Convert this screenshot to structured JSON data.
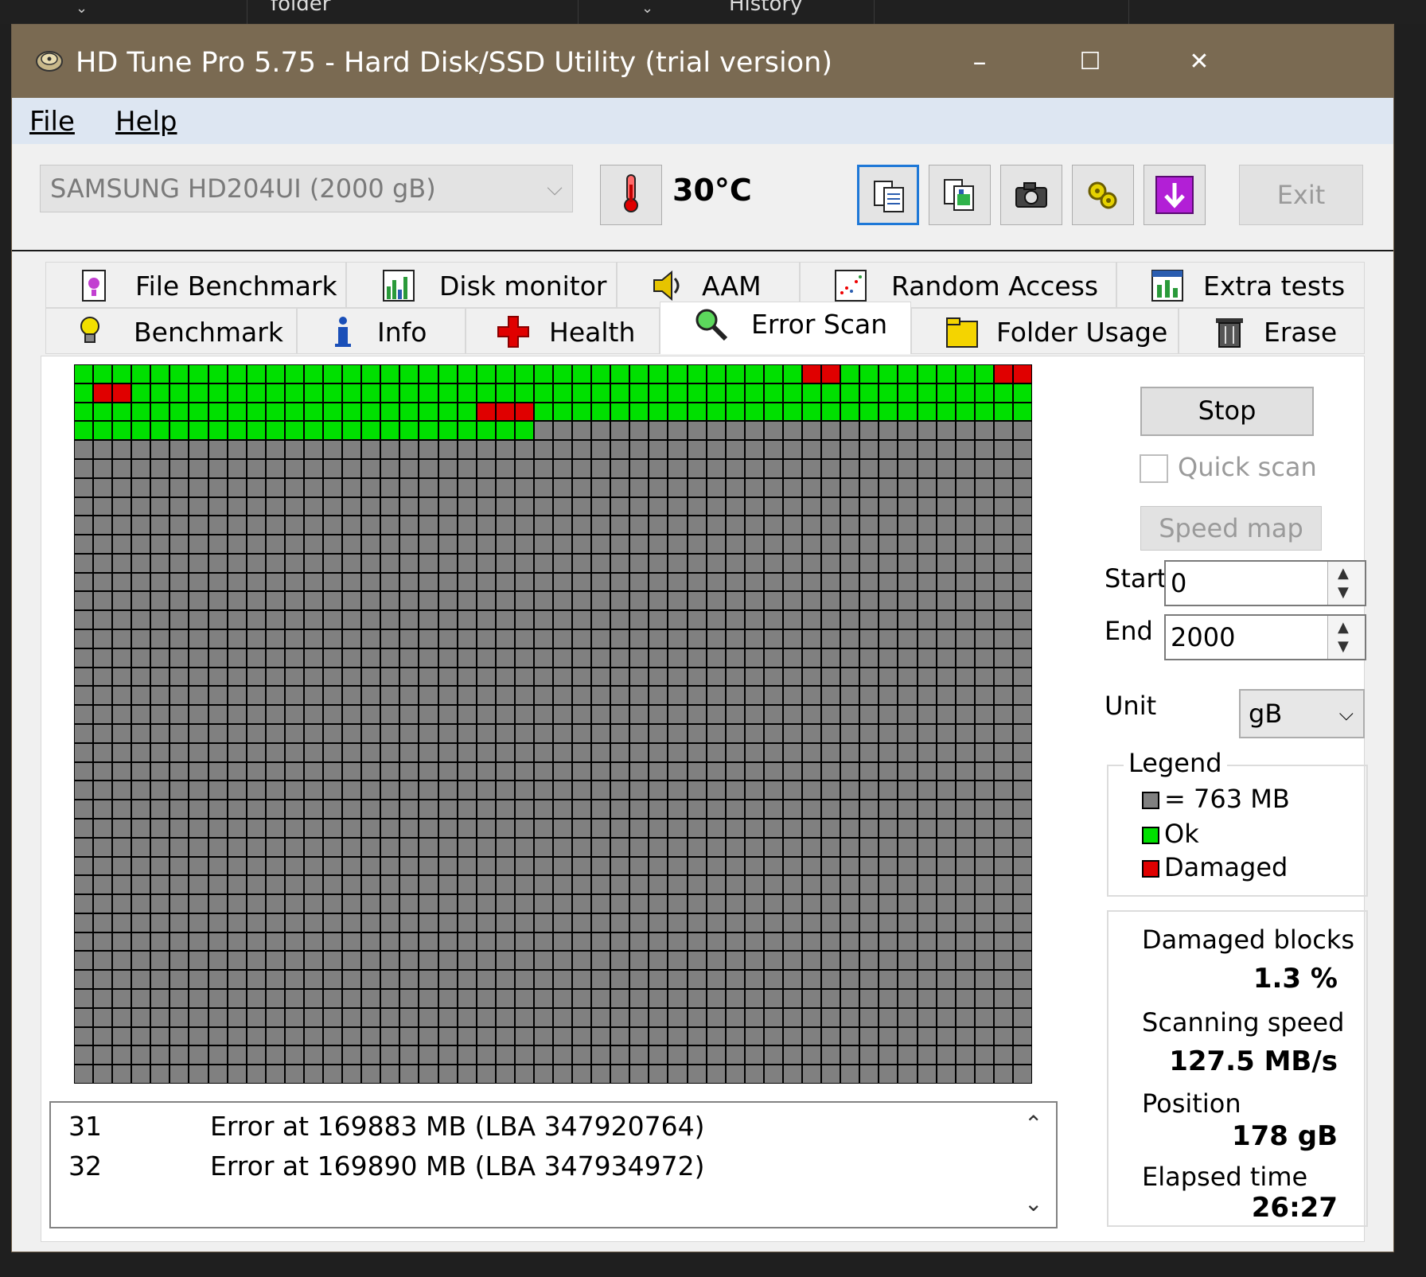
{
  "background": {
    "tabs": [
      {
        "label": "folder"
      },
      {
        "label": "History"
      }
    ]
  },
  "window": {
    "title": "HD Tune Pro 5.75 - Hard Disk/SSD Utility (trial version)",
    "controls": {
      "minimize": "–",
      "maximize": "☐",
      "close": "✕"
    }
  },
  "menu": {
    "file": "File",
    "help": "Help"
  },
  "toolbar": {
    "drive": "SAMSUNG HD204UI (2000 gB)",
    "temperature": "30°C",
    "exit": "Exit",
    "icons": [
      "copy-text-icon",
      "copy-screenshot-icon",
      "camera-icon",
      "options-icon",
      "save-download-icon"
    ]
  },
  "tabs": {
    "row1": [
      "File Benchmark",
      "Disk monitor",
      "AAM",
      "Random Access",
      "Extra tests"
    ],
    "row2": [
      "Benchmark",
      "Info",
      "Health",
      "Error Scan",
      "Folder Usage",
      "Erase"
    ],
    "active": "Error Scan"
  },
  "scan": {
    "grid_cols": 50,
    "grid_rows": 38,
    "scanned_rows_full": 3,
    "scanned_cells_row4": 24,
    "damaged_cells": [
      [
        0,
        38
      ],
      [
        0,
        39
      ],
      [
        0,
        48
      ],
      [
        0,
        49
      ],
      [
        1,
        1
      ],
      [
        1,
        2
      ],
      [
        2,
        21
      ],
      [
        2,
        22
      ],
      [
        2,
        23
      ]
    ],
    "colors": {
      "pending": "#808080",
      "ok": "#00e000",
      "damaged": "#e00000",
      "gridline": "#000000"
    }
  },
  "log": [
    {
      "num": "31",
      "msg": "Error at 169883 MB (LBA 347920764)"
    },
    {
      "num": "32",
      "msg": "Error at 169890 MB (LBA 347934972)"
    }
  ],
  "controls": {
    "stop": "Stop",
    "quick_scan": "Quick scan",
    "speed_map": "Speed map",
    "start_label": "Start",
    "start_value": "0",
    "end_label": "End",
    "end_value": "2000",
    "unit_label": "Unit",
    "unit_value": "gB"
  },
  "legend": {
    "title": "Legend",
    "block": "= 763 MB",
    "ok": "Ok",
    "damaged": "Damaged"
  },
  "stats": {
    "damaged_blocks_label": "Damaged blocks",
    "damaged_blocks_value": "1.3 %",
    "scanning_speed_label": "Scanning speed",
    "scanning_speed_value": "127.5 MB/s",
    "position_label": "Position",
    "position_value": "178 gB",
    "elapsed_label": "Elapsed time",
    "elapsed_value": "26:27"
  }
}
